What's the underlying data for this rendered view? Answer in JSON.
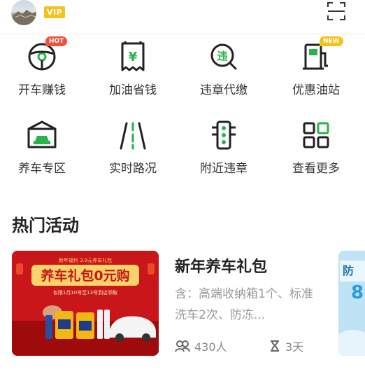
{
  "header": {
    "vip_label": "VIP"
  },
  "services": [
    {
      "label": "开车赚钱",
      "icon": "steering-wheel-icon",
      "badge": "HOT"
    },
    {
      "label": "加油省钱",
      "icon": "fuel-receipt-icon",
      "badge": ""
    },
    {
      "label": "违章代缴",
      "icon": "violation-search-icon",
      "badge": ""
    },
    {
      "label": "优惠油站",
      "icon": "gas-station-icon",
      "badge": "NEW"
    },
    {
      "label": "养车专区",
      "icon": "car-garage-icon",
      "badge": ""
    },
    {
      "label": "实时路况",
      "icon": "road-icon",
      "badge": ""
    },
    {
      "label": "附近违章",
      "icon": "traffic-light-icon",
      "badge": ""
    },
    {
      "label": "查看更多",
      "icon": "more-grid-icon",
      "badge": ""
    }
  ],
  "section": {
    "title": "热门活动"
  },
  "activity": {
    "banner": {
      "top_line": "新年福利 3.9元养车礼包",
      "headline": "养车礼包0元购",
      "subline": "仅限1月10号至13号到店领取"
    },
    "title": "新年养车礼包",
    "description": "含：高端收纳箱1个、标准洗车2次、防冻...",
    "participants": "430人",
    "days_left": "3天"
  },
  "colors": {
    "accent_green": "#2bb24c",
    "hot_red": "#f2503e",
    "new_yellow": "#f3c21b"
  }
}
